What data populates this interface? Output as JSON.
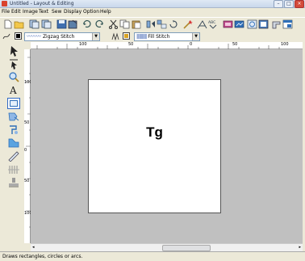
{
  "window": {
    "title": "Untitled - Layout & Editing"
  },
  "menus": [
    "File",
    "Edit",
    "Image",
    "Text",
    "Sew",
    "Display",
    "Option",
    "Help"
  ],
  "stitch": {
    "line_type": "Zigzag Stitch",
    "fill_type": "Fill Stitch"
  },
  "rulers": {
    "top": [
      "100",
      "50",
      "0",
      "50",
      "100"
    ],
    "left": [
      "100",
      "50",
      "0",
      "50",
      "100"
    ]
  },
  "canvas": {
    "text": "Tg"
  },
  "status": "Draws rectangles, circles or arcs.",
  "colors": {
    "accent": "#316ac5",
    "canvas_bg": "#c0c0c0"
  }
}
